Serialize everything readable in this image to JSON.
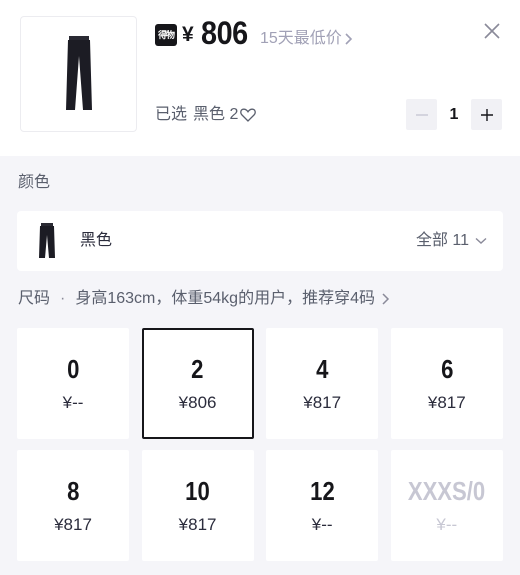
{
  "product": {
    "badge": "得物",
    "currency": "¥",
    "price": "806",
    "lowest_link": "15天最低价",
    "selected_label": "已选",
    "selected_value": "黑色 2",
    "quantity": "1"
  },
  "color_section": {
    "title": "颜色",
    "color_name": "黑色",
    "all_label": "全部 11"
  },
  "size_section": {
    "title": "尺码",
    "recommendation": "身高163cm，体重54kg的用户，推荐穿4码"
  },
  "sizes": [
    {
      "size": "0",
      "price": "¥--"
    },
    {
      "size": "2",
      "price": "¥806"
    },
    {
      "size": "4",
      "price": "¥817"
    },
    {
      "size": "6",
      "price": "¥817"
    },
    {
      "size": "8",
      "price": "¥817"
    },
    {
      "size": "10",
      "price": "¥817"
    },
    {
      "size": "12",
      "price": "¥--"
    },
    {
      "size": "XXXS/0",
      "price": "¥--"
    }
  ],
  "colors": {
    "text": "#16161a",
    "muted": "#a1a1b6",
    "background": "#f5f5f9"
  },
  "icons": [
    "pants-thumbnail-icon",
    "close-icon",
    "chevron-right-icon",
    "heart-icon",
    "minus-icon",
    "plus-icon",
    "chevron-down-icon"
  ]
}
